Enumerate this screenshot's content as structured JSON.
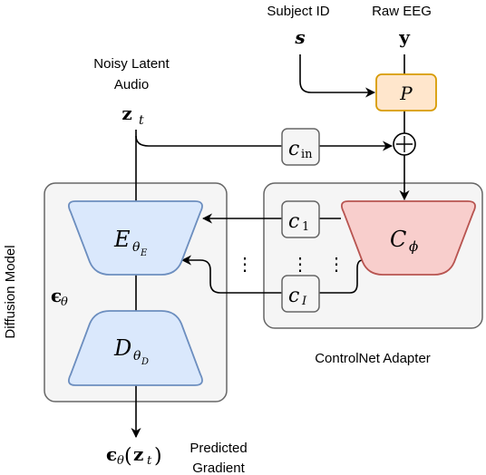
{
  "inputs": {
    "subject_label": "Subject ID",
    "subject_symbol": "s",
    "eeg_label": "Raw EEG",
    "eeg_symbol": "y",
    "latent_label_line1": "Noisy Latent",
    "latent_label_line2": "Audio",
    "latent_symbol": "z",
    "latent_subscript": "t"
  },
  "blocks": {
    "projector": {
      "symbol": "P",
      "fill": "#ffe6cc",
      "stroke": "#d79b00"
    },
    "encoder": {
      "symbol": "E",
      "sub": "θ",
      "subsub": "E",
      "fill": "#dae8fc",
      "stroke": "#6c8ebf"
    },
    "decoder": {
      "symbol": "D",
      "sub": "θ",
      "subsub": "D",
      "fill": "#dae8fc",
      "stroke": "#6c8ebf"
    },
    "controlnet": {
      "symbol": "C",
      "sub": "ϕ",
      "fill": "#f8cecc",
      "stroke": "#b85450"
    },
    "c_in": {
      "symbol": "c",
      "sub": "in"
    },
    "c_1": {
      "symbol": "c",
      "sub": "1"
    },
    "c_I": {
      "symbol": "c",
      "sub": "I"
    },
    "sum_node": "+"
  },
  "containers": {
    "diffusion_model": {
      "label": "Diffusion Model",
      "symbol": "ϵ",
      "sub": "θ"
    },
    "controlnet_adapter": {
      "label": "ControlNet Adapter"
    }
  },
  "output": {
    "symbol": "ϵ",
    "sub": "θ",
    "arg_open": "(",
    "arg": "z",
    "arg_sub": "t",
    "arg_close": ")",
    "label_line1": "Predicted",
    "label_line2": "Gradient"
  },
  "ellipsis": "⋮",
  "colors": {
    "container_fill": "#f5f5f5",
    "container_stroke": "#666666",
    "line": "#000000"
  }
}
